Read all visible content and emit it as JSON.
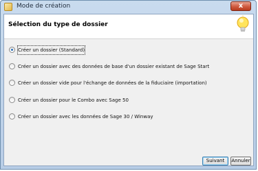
{
  "window": {
    "title": "Mode de création",
    "close_glyph": "x"
  },
  "header": {
    "title": "Sélection du type de dossier",
    "icon": "lightbulb-icon"
  },
  "options": [
    {
      "label": "Créer un dossier (Standard)",
      "checked": true
    },
    {
      "label": "Créer un dossier avec des données de base d'un dossier existant de Sage Start",
      "checked": false
    },
    {
      "label": "Créer un dossier vide pour l'échange de données de la fiduciaire (importation)",
      "checked": false
    },
    {
      "label": "Créer un dossier pour le Combo avec Sage 50",
      "checked": false
    },
    {
      "label": "Créer un dossier avec les données de Sage 30 / Winway",
      "checked": false
    }
  ],
  "buttons": {
    "next": "Suivant",
    "cancel": "Annuler"
  },
  "colors": {
    "frame": "#c9dbee",
    "accent": "#2a6fb8",
    "close": "#cf5a3e"
  }
}
